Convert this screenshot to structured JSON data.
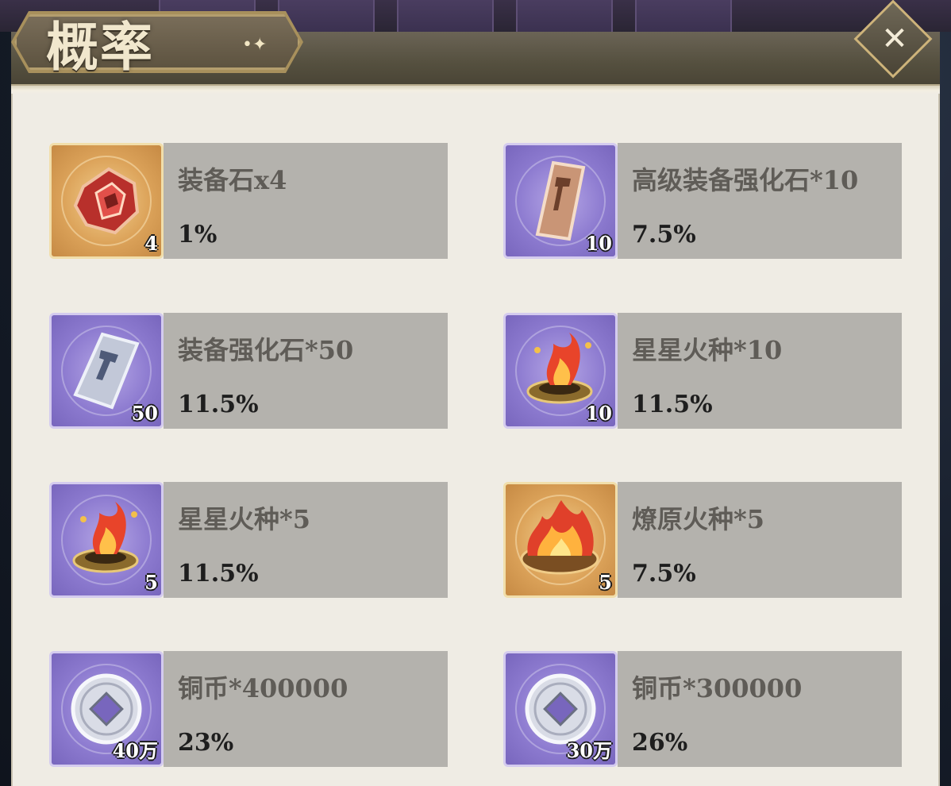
{
  "title": "概率",
  "title_decoration": "•✦",
  "close_icon": "✕",
  "items": [
    {
      "name": "装备石x4",
      "rate": "1%",
      "qty": "4",
      "icon": "red-gem-icon",
      "rarity": "gold"
    },
    {
      "name": "高级装备强化石*10",
      "rate": "7.5%",
      "qty": "10",
      "icon": "copper-ingot-icon",
      "rarity": "purple"
    },
    {
      "name": "装备强化石*50",
      "rate": "11.5%",
      "qty": "50",
      "icon": "silver-ingot-icon",
      "rarity": "purple"
    },
    {
      "name": "星星火种*10",
      "rate": "11.5%",
      "qty": "10",
      "icon": "fire-brazier-icon",
      "rarity": "purple"
    },
    {
      "name": "星星火种*5",
      "rate": "11.5%",
      "qty": "5",
      "icon": "fire-brazier-icon",
      "rarity": "purple"
    },
    {
      "name": "燎原火种*5",
      "rate": "7.5%",
      "qty": "5",
      "icon": "blazing-brazier-icon",
      "rarity": "gold"
    },
    {
      "name": "铜币*400000",
      "rate": "23%",
      "qty": "40万",
      "icon": "silver-coin-icon",
      "rarity": "purple"
    },
    {
      "name": "铜币*300000",
      "rate": "26%",
      "qty": "30万",
      "icon": "silver-coin-icon",
      "rarity": "purple"
    }
  ]
}
